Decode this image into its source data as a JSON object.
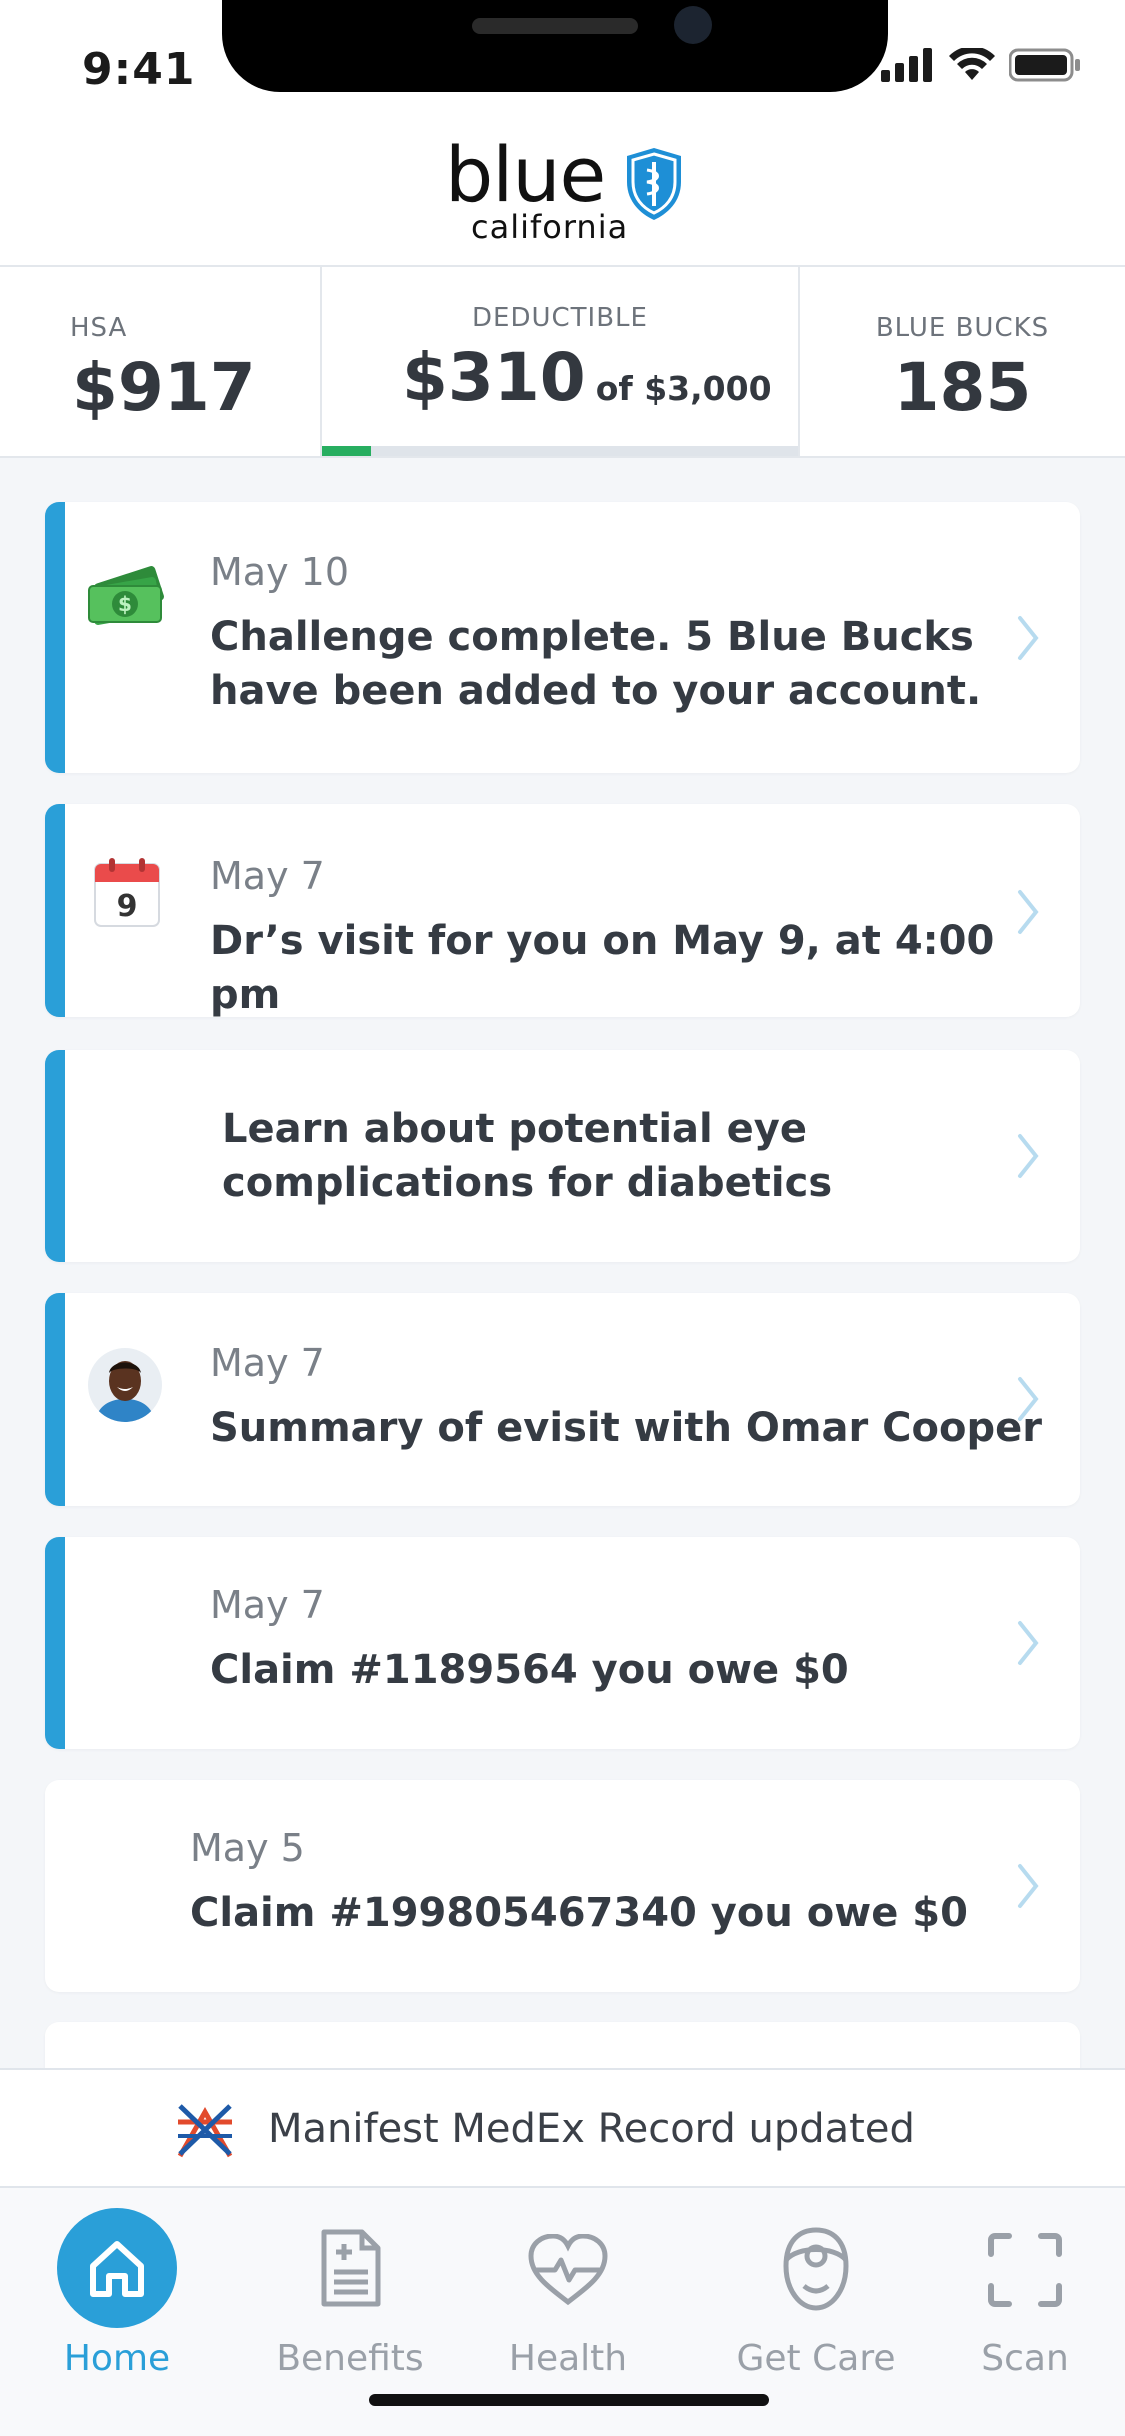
{
  "status": {
    "time": "9:41"
  },
  "brand": {
    "word": "blue",
    "sub": "california"
  },
  "metrics": {
    "hsa": {
      "label": "HSA",
      "value": "$917"
    },
    "deductible": {
      "label": "DEDUCTIBLE",
      "value": "$310",
      "of": "of $3,000",
      "progress_fraction": 0.1033
    },
    "blue_bucks": {
      "label": "BLUE BUCKS",
      "value": "185"
    }
  },
  "feed": [
    {
      "date": "May 10",
      "message": "Challenge complete. 5 Blue Bucks have been added to your account.",
      "icon": "money-icon",
      "unread": true
    },
    {
      "date": "May 7",
      "message": "Dr’s visit for you on May 9, at 4:00 pm",
      "icon": "calendar-icon",
      "calendar_day": "9",
      "unread": true
    },
    {
      "date": "",
      "message": "Learn about potential eye complications for diabetics",
      "icon": "",
      "unread": true
    },
    {
      "date": "May 7",
      "message": "Summary of evisit with Omar Cooper",
      "icon": "avatar",
      "unread": true
    },
    {
      "date": "May 7",
      "message": "Claim #1189564 you owe $0",
      "icon": "",
      "unread": true
    },
    {
      "date": "May 5",
      "message": "Claim #199805467340 you owe $0",
      "icon": "",
      "unread": false
    }
  ],
  "banner": {
    "text": "Manifest MedEx Record updated",
    "icon": "medex-logo-icon"
  },
  "tabs": [
    {
      "label": "Home",
      "icon": "home-icon",
      "active": true
    },
    {
      "label": "Benefits",
      "icon": "benefits-icon",
      "active": false
    },
    {
      "label": "Health",
      "icon": "health-heart-icon",
      "active": false
    },
    {
      "label": "Get Care",
      "icon": "doctor-icon",
      "active": false
    },
    {
      "label": "Scan",
      "icon": "scan-icon",
      "active": false
    }
  ],
  "colors": {
    "accent": "#2a9fd8",
    "progress": "#27ae60",
    "text": "#33383f"
  }
}
